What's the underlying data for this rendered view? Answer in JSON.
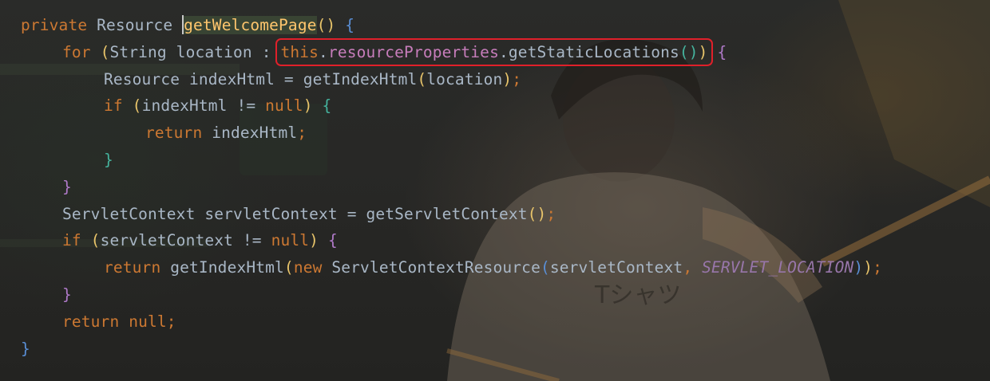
{
  "editor": {
    "lines": [
      {
        "indent": 0,
        "tokens": [
          {
            "t": "private",
            "c": "kw"
          },
          {
            "t": " ",
            "c": "id"
          },
          {
            "t": "Resource",
            "c": "id"
          },
          {
            "t": " ",
            "c": "id"
          },
          {
            "caret": true
          },
          {
            "t": "getWelcomePage",
            "c": "fn",
            "hl": true
          },
          {
            "t": "()",
            "c": "br-y"
          },
          {
            "t": " ",
            "c": "id"
          },
          {
            "t": "{",
            "c": "br-b"
          }
        ]
      },
      {
        "indent": 1,
        "tokens": [
          {
            "t": "for",
            "c": "kw"
          },
          {
            "t": " ",
            "c": "id"
          },
          {
            "t": "(",
            "c": "br-y"
          },
          {
            "t": "String location : ",
            "c": "id"
          },
          {
            "box": [
              {
                "t": "this",
                "c": "kw"
              },
              {
                "t": ".",
                "c": "id"
              },
              {
                "t": "resourceProperties",
                "c": "fld"
              },
              {
                "t": ".getStaticLocations",
                "c": "id"
              },
              {
                "t": "()",
                "c": "br-g"
              },
              {
                "t": ")",
                "c": "br-y"
              }
            ]
          },
          {
            "t": " ",
            "c": "id"
          },
          {
            "t": "{",
            "c": "br-p"
          }
        ]
      },
      {
        "indent": 2,
        "tokens": [
          {
            "t": "Resource indexHtml = getIndexHtml",
            "c": "id"
          },
          {
            "t": "(",
            "c": "br-y"
          },
          {
            "t": "location",
            "c": "id"
          },
          {
            "t": ")",
            "c": "br-y"
          },
          {
            "t": ";",
            "c": "kw"
          }
        ]
      },
      {
        "indent": 2,
        "tokens": [
          {
            "t": "if",
            "c": "kw"
          },
          {
            "t": " ",
            "c": "id"
          },
          {
            "t": "(",
            "c": "br-y"
          },
          {
            "t": "indexHtml != ",
            "c": "id"
          },
          {
            "t": "null",
            "c": "kw"
          },
          {
            "t": ")",
            "c": "br-y"
          },
          {
            "t": " ",
            "c": "id"
          },
          {
            "t": "{",
            "c": "br-g"
          }
        ]
      },
      {
        "indent": 3,
        "tokens": [
          {
            "t": "return",
            "c": "kw"
          },
          {
            "t": " indexHtml",
            "c": "id"
          },
          {
            "t": ";",
            "c": "kw"
          }
        ]
      },
      {
        "indent": 2,
        "tokens": [
          {
            "t": "}",
            "c": "br-g"
          }
        ]
      },
      {
        "indent": 1,
        "tokens": [
          {
            "t": "}",
            "c": "br-p"
          }
        ]
      },
      {
        "indent": 1,
        "tokens": [
          {
            "t": "ServletContext servletContext = getServletContext",
            "c": "id"
          },
          {
            "t": "()",
            "c": "br-y"
          },
          {
            "t": ";",
            "c": "kw"
          }
        ]
      },
      {
        "indent": 1,
        "tokens": [
          {
            "t": "if",
            "c": "kw"
          },
          {
            "t": " ",
            "c": "id"
          },
          {
            "t": "(",
            "c": "br-y"
          },
          {
            "t": "servletContext != ",
            "c": "id"
          },
          {
            "t": "null",
            "c": "kw"
          },
          {
            "t": ")",
            "c": "br-y"
          },
          {
            "t": " ",
            "c": "id"
          },
          {
            "t": "{",
            "c": "br-p"
          }
        ]
      },
      {
        "indent": 2,
        "tokens": [
          {
            "t": "return",
            "c": "kw"
          },
          {
            "t": " getIndexHtml",
            "c": "id"
          },
          {
            "t": "(",
            "c": "br-y"
          },
          {
            "t": "new",
            "c": "kw"
          },
          {
            "t": " ServletContextResource",
            "c": "id"
          },
          {
            "t": "(",
            "c": "br-b"
          },
          {
            "t": "servletContext",
            "c": "id"
          },
          {
            "t": ",",
            "c": "kw"
          },
          {
            "t": " ",
            "c": "id"
          },
          {
            "t": "SERVLET_LOCATION",
            "c": "cst"
          },
          {
            "t": ")",
            "c": "br-b"
          },
          {
            "t": ")",
            "c": "br-y"
          },
          {
            "t": ";",
            "c": "kw"
          }
        ]
      },
      {
        "indent": 1,
        "tokens": [
          {
            "t": "}",
            "c": "br-p"
          }
        ]
      },
      {
        "indent": 1,
        "tokens": [
          {
            "t": "return",
            "c": "kw"
          },
          {
            "t": " ",
            "c": "id"
          },
          {
            "t": "null",
            "c": "kw"
          },
          {
            "t": ";",
            "c": "kw"
          }
        ]
      },
      {
        "indent": 0,
        "tokens": [
          {
            "t": "}",
            "c": "br-b"
          }
        ]
      }
    ]
  },
  "colors": {
    "keyword": "#cc7832",
    "identifier": "#a9b7c6",
    "method_declaration": "#ffc66d",
    "field": "#c77dbb",
    "constant": "#9876aa",
    "highlight_box": "#e0202a"
  },
  "wallpaper": {
    "icon": "anime-boy-wallpaper",
    "shirt_text": "Tシャツ"
  }
}
